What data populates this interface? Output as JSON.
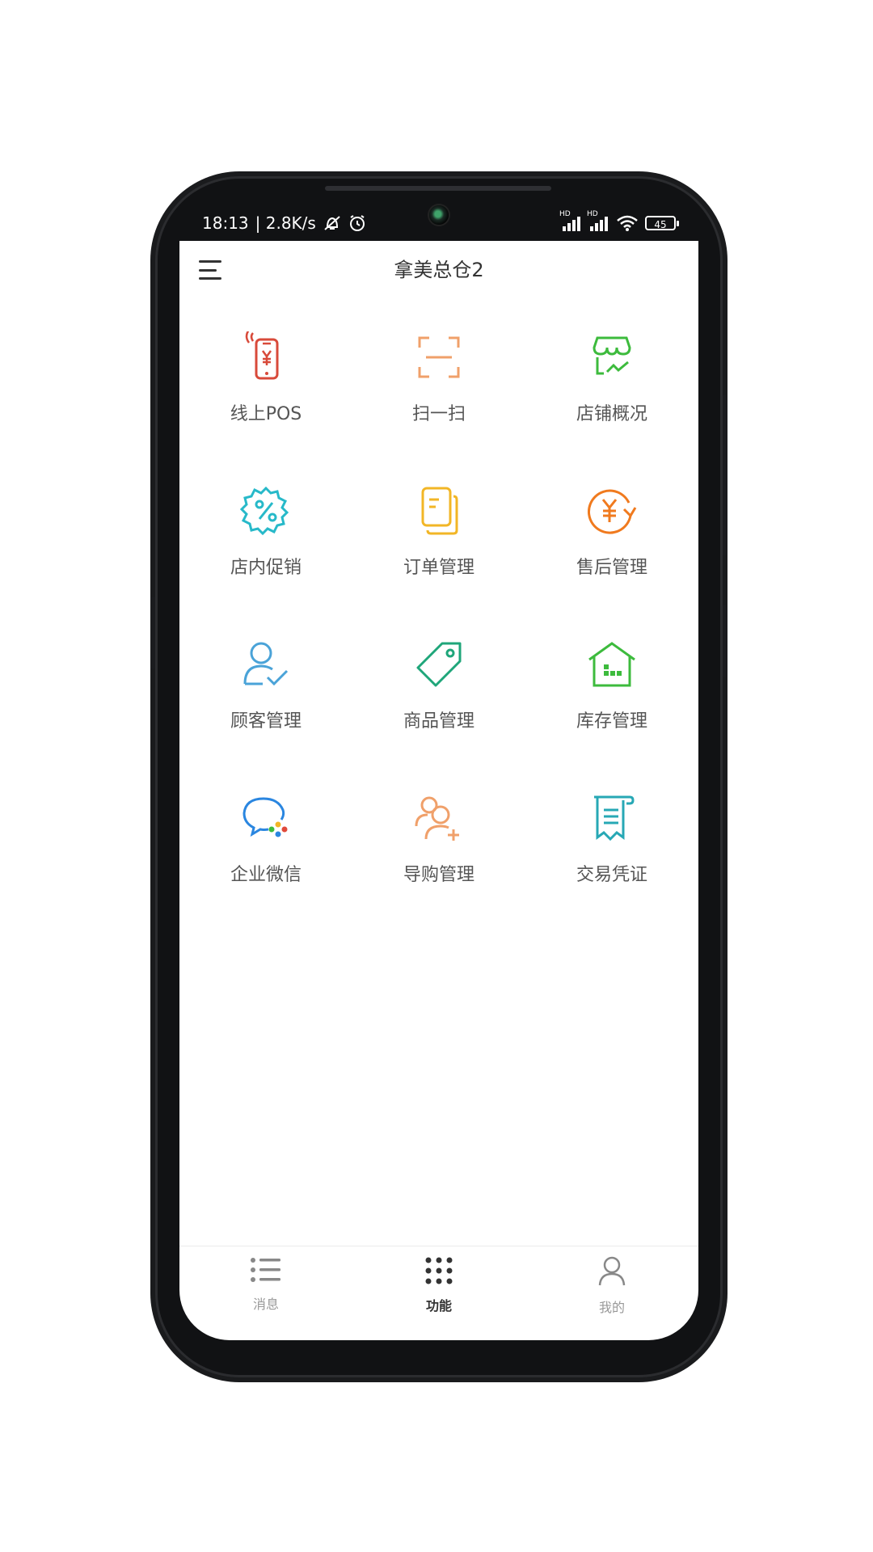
{
  "status_bar": {
    "time": "18:13",
    "net_speed": "| 2.8K/s",
    "battery": "45",
    "signal_label_1": "HD",
    "signal_label_2": "HD"
  },
  "header": {
    "title": "拿美总仓2"
  },
  "functions": [
    {
      "label": "线上POS",
      "icon": "mobile-pos-icon",
      "color": "#d84a3a"
    },
    {
      "label": "扫一扫",
      "icon": "scan-icon",
      "color": "#f0a06a"
    },
    {
      "label": "店铺概况",
      "icon": "store-overview-icon",
      "color": "#3dbb3d"
    },
    {
      "label": "店内促销",
      "icon": "promotion-icon",
      "color": "#27b9c9"
    },
    {
      "label": "订单管理",
      "icon": "order-icon",
      "color": "#f2b626"
    },
    {
      "label": "售后管理",
      "icon": "after-sale-icon",
      "color": "#f07a1e"
    },
    {
      "label": "顾客管理",
      "icon": "customer-icon",
      "color": "#4aa3d8"
    },
    {
      "label": "商品管理",
      "icon": "product-tag-icon",
      "color": "#1fa67a"
    },
    {
      "label": "库存管理",
      "icon": "inventory-icon",
      "color": "#3dbb3d"
    },
    {
      "label": "企业微信",
      "icon": "wecom-icon",
      "color": "#2a86e0"
    },
    {
      "label": "导购管理",
      "icon": "shopping-guide-icon",
      "color": "#f0a06a"
    },
    {
      "label": "交易凭证",
      "icon": "receipt-icon",
      "color": "#27a8b5"
    }
  ],
  "bottom_nav": [
    {
      "label": "消息",
      "icon": "list-icon",
      "active": false
    },
    {
      "label": "功能",
      "icon": "grid-icon",
      "active": true
    },
    {
      "label": "我的",
      "icon": "user-icon",
      "active": false
    }
  ]
}
